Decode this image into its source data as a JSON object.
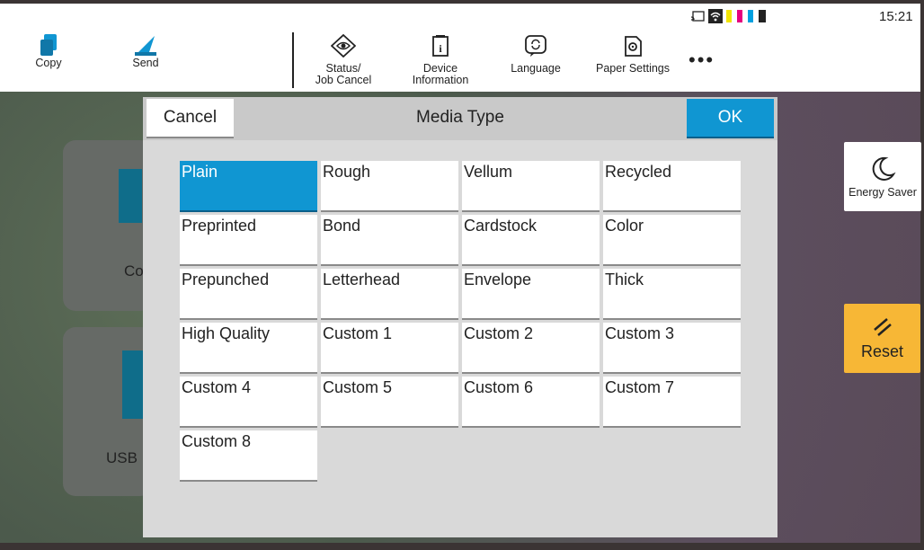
{
  "status_bar": {
    "time": "15:21"
  },
  "toolbar": {
    "copy_label": "Copy",
    "send_label": "Send",
    "status_label": "Status/\nJob Cancel",
    "device_label": "Device\nInformation",
    "language_label": "Language",
    "paper_label": "Paper Settings",
    "more_label": "•••"
  },
  "home": {
    "tile1_label": "Co",
    "tile2_label": "USB"
  },
  "side": {
    "energy_label": "Energy Saver",
    "reset_label": "Reset"
  },
  "dialog": {
    "title": "Media Type",
    "cancel_label": "Cancel",
    "ok_label": "OK",
    "options": [
      "Plain",
      "Rough",
      "Vellum",
      "Recycled",
      "Preprinted",
      "Bond",
      "Cardstock",
      "Color",
      "Prepunched",
      "Letterhead",
      "Envelope",
      "Thick",
      "High Quality",
      "Custom 1",
      "Custom 2",
      "Custom 3",
      "Custom 4",
      "Custom 5",
      "Custom 6",
      "Custom 7",
      "Custom 8"
    ],
    "selected": "Plain"
  },
  "colors": {
    "accent": "#1096d2",
    "reset": "#f7b736"
  }
}
